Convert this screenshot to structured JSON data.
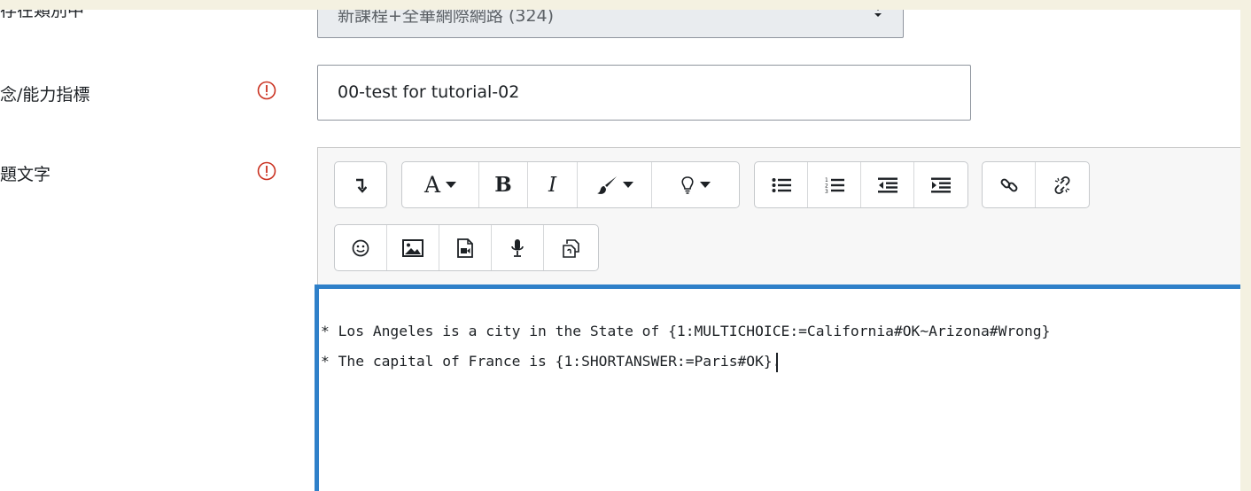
{
  "form": {
    "category_label": "存在類別中",
    "category_value": "新課程+全華網際網路 (324)",
    "name_label": "念/能力指標",
    "name_value": "00-test for tutorial-02",
    "text_label": "題文字"
  },
  "editor": {
    "row1_groups": [
      [
        "collapse-icon"
      ],
      [
        "font-style-icon",
        "bold-icon",
        "italic-icon",
        "brush-color-icon",
        "lightbulb-icon"
      ],
      [
        "unordered-list-icon",
        "ordered-list-icon",
        "outdent-icon",
        "indent-icon"
      ],
      [
        "link-icon",
        "unlink-icon"
      ]
    ],
    "row2_groups": [
      [
        "emoji-icon",
        "image-icon",
        "media-icon",
        "microphone-icon",
        "copy-paste-icon"
      ]
    ],
    "font_button_letter": "A",
    "bold_letter": "B",
    "italic_letter": "I",
    "content_lines": [
      "* Los Angeles is a city in the State of {1:MULTICHOICE:=California#OK~Arizona#Wrong}",
      "* The capital of France is {1:SHORTANSWER:=Paris#OK}."
    ]
  },
  "colors": {
    "required": "#ca3120",
    "focus_border": "#2f80c9"
  }
}
